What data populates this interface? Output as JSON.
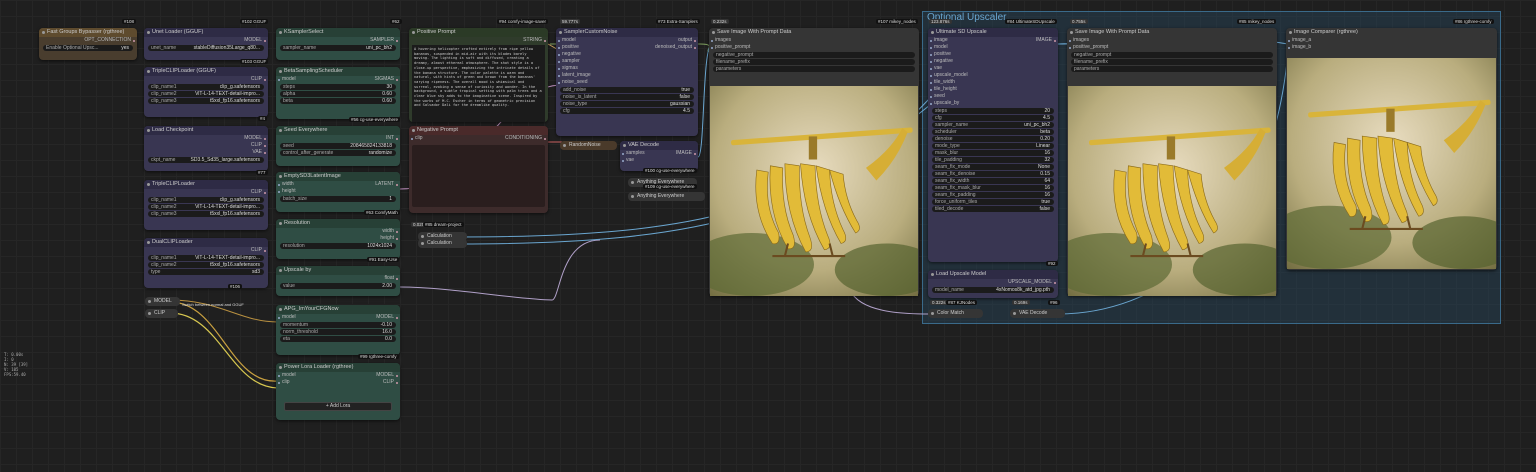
{
  "groups": [
    {
      "title": "Optional Upscaler"
    }
  ],
  "status": {
    "lines": [
      "T: 0.00s",
      "I: 0",
      "N: 39 [39]",
      "V: 105",
      "FPS:59.40"
    ]
  },
  "nodes": {
    "fast_groups": {
      "title": "Fast Groups Bypasser (rgthree)",
      "badge": "#108",
      "output": "OPT_CONNECTION",
      "toggle_label": "Enable Optional Upsc...",
      "toggle_value": "yes"
    },
    "unet_loader": {
      "title": "Unet Loader (GGUF)",
      "badge": "#102 GGUF",
      "output": "MODEL",
      "widget_name": "unet_name",
      "widget_value": "stableDiffusion35Large_q80...",
      "footer": "#103 GGUF"
    },
    "triple_clip_1": {
      "title": "TripleCLIPLoader (GGUF)",
      "output": "CLIP",
      "footer": "#4",
      "widgets": [
        {
          "name": "clip_name1",
          "value": "clip_g.safetensors"
        },
        {
          "name": "clip_name2",
          "value": "ViT-L-14-TEXT-detail-impro..."
        },
        {
          "name": "clip_name3",
          "value": "t5xxl_fp16.safetensors"
        }
      ]
    },
    "load_checkpoint": {
      "title": "Load Checkpoint",
      "outputs": [
        "MODEL",
        "CLIP",
        "VAE"
      ],
      "widget_name": "ckpt_name",
      "widget_value": "SD3.5_Sd35_large.safetensors",
      "footer": "#77"
    },
    "triple_clip_2": {
      "title": "TripleCLIPLoader",
      "output": "CLIP",
      "widgets": [
        {
          "name": "clip_name1",
          "value": "clip_g.safetensors"
        },
        {
          "name": "clip_name2",
          "value": "ViT-L-14-TEXT-detail-impro..."
        },
        {
          "name": "clip_name3",
          "value": "t5xxl_fp16.safetensors"
        }
      ]
    },
    "dual_clip": {
      "title": "DualCLIPLoader",
      "output": "CLIP",
      "footer": "#106",
      "widgets": [
        {
          "name": "clip_name1",
          "value": "ViT-L-14-TEXT-detail-impro..."
        },
        {
          "name": "clip_name2",
          "value": "t5xxl_fp16.safetensors"
        },
        {
          "name": "type",
          "value": "sd3"
        }
      ]
    },
    "model_strip": {
      "label": "MODEL",
      "note": "Switch between normal and GGUF"
    },
    "clip_strip": {
      "label": "CLIP"
    },
    "ksampler_select": {
      "title": "KSamplerSelect",
      "badge": "#62",
      "output": "SAMPLER",
      "widget_name": "sampler_name",
      "widget_value": "uni_pc_bh2"
    },
    "beta_scheduler": {
      "title": "BetaSamplingScheduler",
      "output": "SIGMAS",
      "footer": "#56 cg-use-everywhere",
      "inputs": [
        "model"
      ],
      "widgets": [
        {
          "name": "steps",
          "value": "30"
        },
        {
          "name": "alpha",
          "value": "0.60"
        },
        {
          "name": "beta",
          "value": "0.60"
        }
      ]
    },
    "seed_everywhere": {
      "title": "Seed Everywhere",
      "output": "INT",
      "widgets": [
        {
          "name": "seed",
          "value": "208465824133818"
        },
        {
          "name": "control_after_generate",
          "value": "randomize"
        }
      ]
    },
    "empty_latent": {
      "title": "EmptySD3LatentImage",
      "output": "LATENT",
      "inputs": [
        "width",
        "height"
      ],
      "widgets": [
        {
          "name": "batch_size",
          "value": "1"
        }
      ],
      "footer": "#63 ComfyMath"
    },
    "resolution": {
      "title": "Resolution",
      "outputs": [
        "width",
        "height"
      ],
      "footer": "#91 Easy-Use",
      "widgets": [
        {
          "name": "resolution",
          "value": "1024x1024"
        }
      ]
    },
    "upscale_by": {
      "title": "Upscale by",
      "output": "float",
      "widgets": [
        {
          "name": "value",
          "value": "2.00"
        }
      ]
    },
    "apg": {
      "title": "APG_ImYourCFGNow",
      "output": "MODEL",
      "inputs": [
        "model"
      ],
      "footer": "#99 rgthree-comfy",
      "widgets": [
        {
          "name": "momentum",
          "value": "-0.10"
        },
        {
          "name": "norm_threshold",
          "value": "16.0"
        },
        {
          "name": "eta",
          "value": "0.0"
        }
      ]
    },
    "power_lora": {
      "title": "Power Lora Loader (rgthree)",
      "inputs": [
        "model",
        "clip"
      ],
      "outputs": [
        "MODEL",
        "CLIP"
      ],
      "add_label": "Add Lora"
    },
    "positive_prompt": {
      "title": "Positive Prompt",
      "badge": "#94 comfy-image-saver",
      "output": "STRING",
      "text": "A hovering helicopter crafted entirely from ripe yellow bananas, suspended in mid-air with its blades barely moving. The lighting is soft and diffused, creating a dreamy, almost ethereal atmosphere. The shot style is a close-up perspective, emphasizing the intricate details of the banana structure. The color palette is warm and natural, with hints of green and brown from the bananas' varying ripeness. The overall mood is whimsical and surreal, evoking a sense of curiosity and wonder. In the background, a subtle tropical setting with palm trees and a clear blue sky adds to the imaginative scene. Inspired by the works of M.C. Escher in terms of geometric precision and Salvador Dali for the dreamlike quality."
    },
    "negative_prompt": {
      "title": "Negative Prompt",
      "inputs": [
        "clip"
      ],
      "output": "CONDITIONING"
    },
    "extra_samplers_badge": "#73 Extra-Samplers",
    "sampler_custom_noise": {
      "title": "SamplerCustomNoise",
      "time": "59.777s",
      "inputs": [
        "model",
        "positive",
        "negative",
        "sampler",
        "sigmas",
        "latent_image",
        "noise_seed"
      ],
      "outputs": [
        "output",
        "denoised_output"
      ],
      "widgets": [
        {
          "name": "add_noise",
          "value": "true"
        },
        {
          "name": "noise_is_latent",
          "value": "false"
        },
        {
          "name": "noise_type",
          "value": "gaussian"
        },
        {
          "name": "cfg",
          "value": "4.5"
        }
      ]
    },
    "random_noise": {
      "label": "RandomNoise"
    },
    "vae_decode_1": {
      "title": "VAE Decode",
      "inputs": [
        "samples",
        "vae"
      ],
      "output": "IMAGE",
      "footer": "#100 cg-use-everywhere"
    },
    "anything_1": {
      "label": "Anything Everywhere",
      "badge": "#109 cg-use-everywhere"
    },
    "anything_2": {
      "label": "Anything Everywhere"
    },
    "calc_badge": "#85 dream-project",
    "calc_time": "0.025s",
    "calculation_1": {
      "label": "Calculation"
    },
    "calculation_2": {
      "label": "Calculation"
    },
    "save_image_1": {
      "title": "Save Image With Prompt Data",
      "time": "0.232s",
      "badge": "#107 mikey_nodes",
      "inputs": [
        "images",
        "positive_prompt"
      ],
      "widgets": [
        "negative_prompt",
        "filename_prefix",
        "parameters"
      ]
    },
    "ultimate_upscale": {
      "title": "Ultimate SD Upscale",
      "time": "123.876s",
      "badge": "#84 UltimateSDUpscale",
      "output": "IMAGE",
      "footer": "#92",
      "inputs": [
        "image",
        "model",
        "positive",
        "negative",
        "vae",
        "upscale_model",
        "tile_width",
        "tile_height",
        "seed",
        "upscale_by"
      ],
      "widgets": [
        {
          "name": "steps",
          "value": "20"
        },
        {
          "name": "cfg",
          "value": "4.5"
        },
        {
          "name": "sampler_name",
          "value": "uni_pc_bh2"
        },
        {
          "name": "scheduler",
          "value": "beta"
        },
        {
          "name": "denoise",
          "value": "0.20"
        },
        {
          "name": "mode_type",
          "value": "Linear"
        },
        {
          "name": "mask_blur",
          "value": "16"
        },
        {
          "name": "tile_padding",
          "value": "32"
        },
        {
          "name": "seam_fix_mode",
          "value": "None"
        },
        {
          "name": "seam_fix_denoise",
          "value": "0.15"
        },
        {
          "name": "seam_fix_width",
          "value": "64"
        },
        {
          "name": "seam_fix_mask_blur",
          "value": "16"
        },
        {
          "name": "seam_fix_padding",
          "value": "16"
        },
        {
          "name": "force_uniform_tiles",
          "value": "true"
        },
        {
          "name": "tiled_decode",
          "value": "false"
        }
      ]
    },
    "load_upscale": {
      "title": "Load Upscale Model",
      "output": "UPSCALE_MODEL",
      "badge": "#96",
      "widget_name": "model_name",
      "widget_value": "4xNomos8k_atd_jpg.pth"
    },
    "color_match": {
      "label": "Color Match",
      "time": "0.322s",
      "badge": "#87 KJNodes"
    },
    "vae_decode_2": {
      "label": "VAE Decode",
      "time": "0.169s"
    },
    "save_image_2": {
      "title": "Save Image With Prompt Data",
      "time": "0.755s",
      "badge": "#85 mikey_nodes",
      "inputs": [
        "images",
        "positive_prompt"
      ],
      "widgets": [
        "negative_prompt",
        "filename_prefix",
        "parameters"
      ]
    },
    "image_comparer": {
      "title": "Image Comparer (rgthree)",
      "badge": "#86 rgthree-comfy",
      "inputs": [
        "image_a",
        "image_b"
      ]
    }
  },
  "colors": {
    "canvas": "#1f1f1f",
    "green_node": "#2f4d44",
    "purple_node": "#393652",
    "group": "#3a6a8a"
  }
}
